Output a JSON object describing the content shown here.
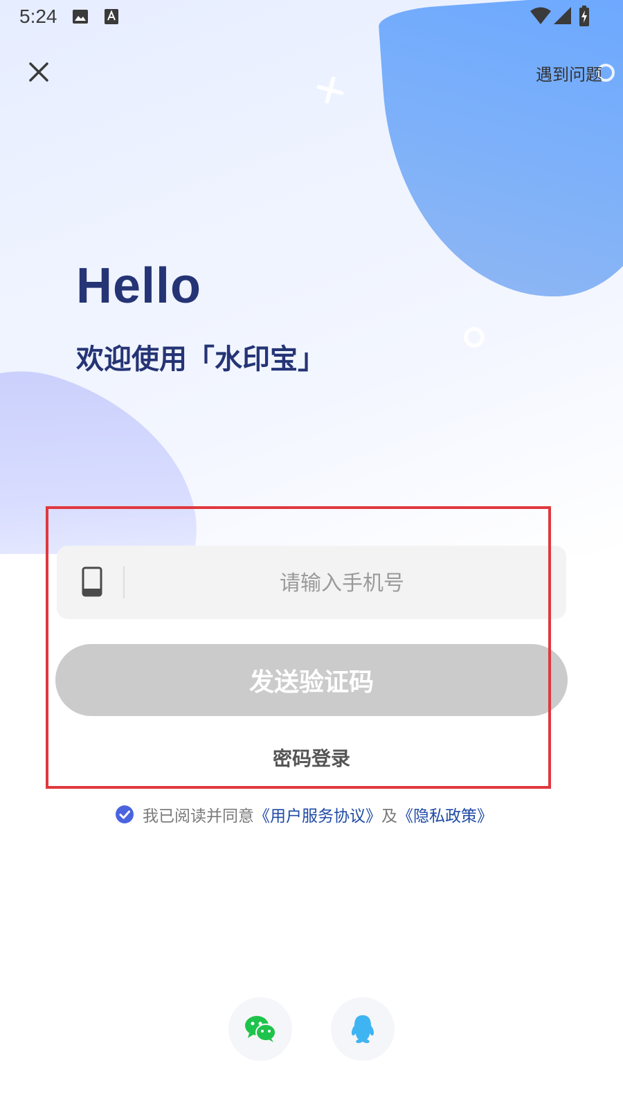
{
  "status_bar": {
    "time": "5:24",
    "icons": [
      "image-notification-icon",
      "text-notification-icon",
      "wifi-icon",
      "signal-icon",
      "battery-charging-icon"
    ]
  },
  "header": {
    "close_icon": "close-icon",
    "help_label": "遇到问题"
  },
  "hero": {
    "greeting": "Hello",
    "welcome": "欢迎使用「水印宝」"
  },
  "form": {
    "phone_icon": "phone-icon",
    "phone_placeholder": "请输入手机号",
    "phone_value": "",
    "send_code_label": "发送验证码",
    "password_login_label": "密码登录"
  },
  "agreement": {
    "checked": true,
    "prefix": "我已阅读并同意",
    "terms_link": "《用户服务协议》",
    "conjunction": "及",
    "privacy_link": "《隐私政策》"
  },
  "social_login": {
    "wechat_icon": "wechat-icon",
    "qq_icon": "qq-icon"
  },
  "colors": {
    "title": "#253475",
    "link": "#1f4aa5",
    "check": "#4a64e0",
    "disabled_button": "#cbcbcb",
    "wechat": "#1ec34b",
    "qq": "#3fb4f2",
    "highlight": "#e0383e"
  }
}
